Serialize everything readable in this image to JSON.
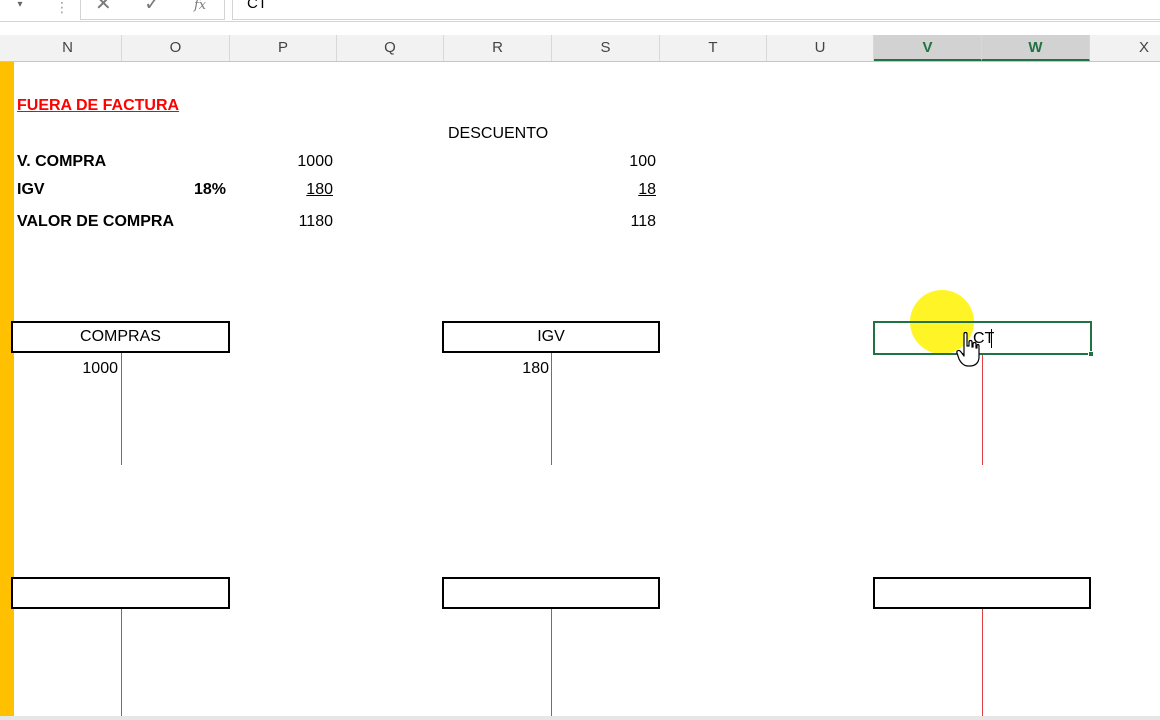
{
  "formula_bar": {
    "name_box_arrow": "▾",
    "dots": "⋮",
    "cancel_icon": "✕",
    "enter_icon": "✓",
    "fx_label": "fx",
    "value": "CT"
  },
  "columns": [
    "N",
    "O",
    "P",
    "Q",
    "R",
    "S",
    "T",
    "U",
    "V",
    "W",
    "X"
  ],
  "selected_columns": [
    "V",
    "W"
  ],
  "sheet": {
    "title": "FUERA DE FACTURA",
    "descuento_label": "DESCUENTO",
    "rows": [
      {
        "label": "V. COMPRA",
        "rate": "",
        "amount": "1000",
        "discount": "100"
      },
      {
        "label": "IGV",
        "rate": "18%",
        "amount": "180",
        "discount": "18"
      },
      {
        "label": "VALOR DE COMPRA",
        "rate": "",
        "amount": "1180",
        "discount": "118"
      }
    ]
  },
  "t_accounts": [
    {
      "title": "COMPRAS",
      "debit": "1000"
    },
    {
      "title": "IGV",
      "debit": "180"
    },
    {
      "title": "",
      "debit": ""
    },
    {
      "title": "",
      "debit": ""
    },
    {
      "title": "",
      "debit": ""
    }
  ],
  "active_cell": {
    "typed_text": "CT"
  },
  "colors": {
    "accent_strip": "#ffc000",
    "selection_green": "#217346",
    "title_red": "#ff0000",
    "t_line_red": "#e04040",
    "cursor_highlight": "#fff200"
  }
}
